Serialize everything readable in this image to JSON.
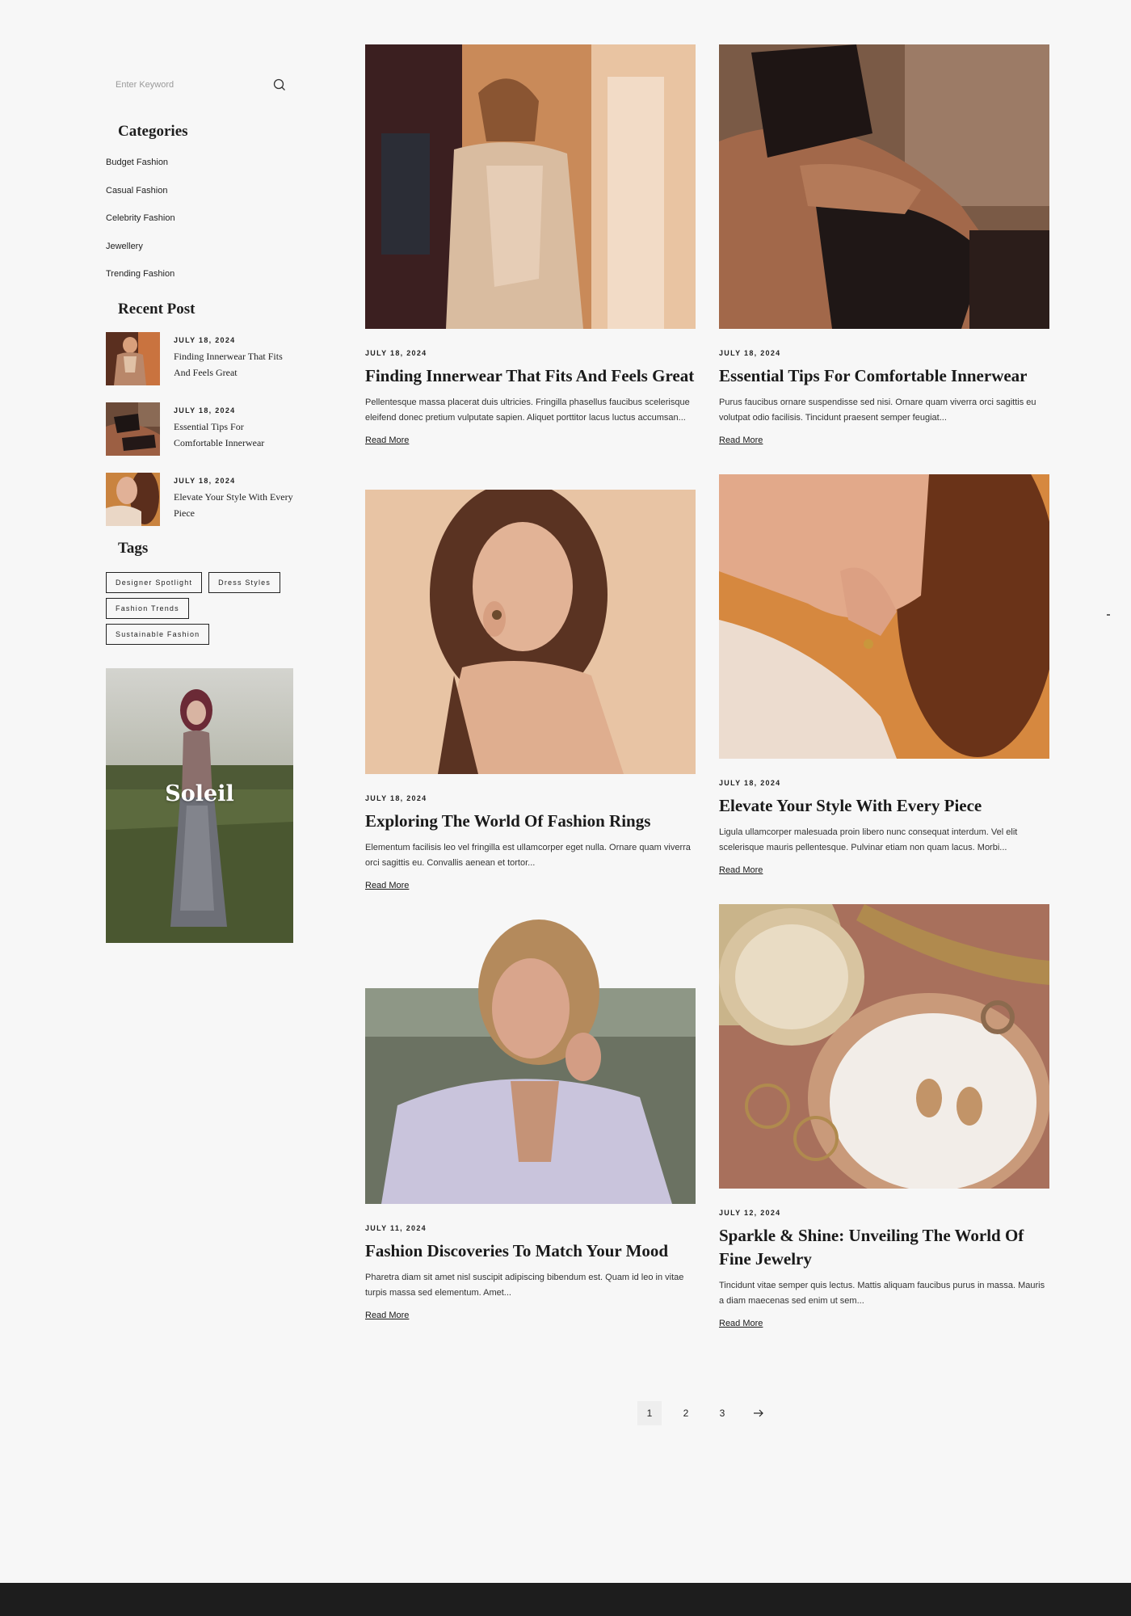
{
  "search": {
    "placeholder": "Enter Keyword"
  },
  "categories": {
    "heading": "Categories",
    "items": [
      "Budget Fashion",
      "Casual Fashion",
      "Celebrity Fashion",
      "Jewellery",
      "Trending Fashion"
    ]
  },
  "recent": {
    "heading": "Recent Post",
    "items": [
      {
        "date": "JULY 18, 2024",
        "title": "Finding Innerwear That Fits And Feels Great"
      },
      {
        "date": "JULY 18, 2024",
        "title": "Essential Tips For Comfortable Innerwear"
      },
      {
        "date": "JULY 18, 2024",
        "title": "Elevate Your Style With Every Piece"
      }
    ]
  },
  "tags": {
    "heading": "Tags",
    "items": [
      "Designer Spotlight",
      "Dress Styles",
      "Fashion Trends",
      "Sustainable Fashion"
    ]
  },
  "promo": {
    "text": "Soleil"
  },
  "posts": [
    {
      "date": "JULY 18, 2024",
      "title": "Finding Innerwear That Fits And Feels Great",
      "excerpt": "Pellentesque massa placerat duis ultricies. Fringilla phasellus faucibus scelerisque eleifend donec pretium vulputate sapien. Aliquet porttitor lacus luctus accumsan...",
      "read_more": "Read More"
    },
    {
      "date": "JULY 18, 2024",
      "title": "Essential Tips For Comfortable Innerwear",
      "excerpt": "Purus faucibus ornare suspendisse sed nisi. Ornare quam viverra orci sagittis eu volutpat odio facilisis. Tincidunt praesent semper feugiat...",
      "read_more": "Read More"
    },
    {
      "date": "JULY 18, 2024",
      "title": "Exploring The World Of Fashion Rings",
      "excerpt": "Elementum facilisis leo vel fringilla est ullamcorper eget nulla. Ornare quam viverra orci sagittis eu. Convallis aenean et tortor...",
      "read_more": "Read More"
    },
    {
      "date": "JULY 18, 2024",
      "title": "Elevate Your Style With Every Piece",
      "excerpt": "Ligula ullamcorper malesuada proin libero nunc consequat interdum. Vel elit scelerisque mauris pellentesque. Pulvinar etiam non quam lacus. Morbi...",
      "read_more": "Read More"
    },
    {
      "date": "JULY 11, 2024",
      "title": "Fashion Discoveries To Match Your Mood",
      "excerpt": "Pharetra diam sit amet nisl suscipit adipiscing bibendum est. Quam id leo in vitae turpis massa sed elementum. Amet...",
      "read_more": "Read More"
    },
    {
      "date": "JULY 12, 2024",
      "title": "Sparkle & Shine: Unveiling The World Of Fine Jewelry",
      "excerpt": "Tincidunt vitae semper quis lectus. Mattis aliquam faucibus purus in massa. Mauris a diam maecenas sed enim ut sem...",
      "read_more": "Read More"
    }
  ],
  "pagination": {
    "pages": [
      "1",
      "2",
      "3"
    ],
    "current": "1"
  },
  "colors": {
    "background": "#f7f7f7",
    "footer": "#1d1d1d",
    "text": "#1a1a1a"
  }
}
